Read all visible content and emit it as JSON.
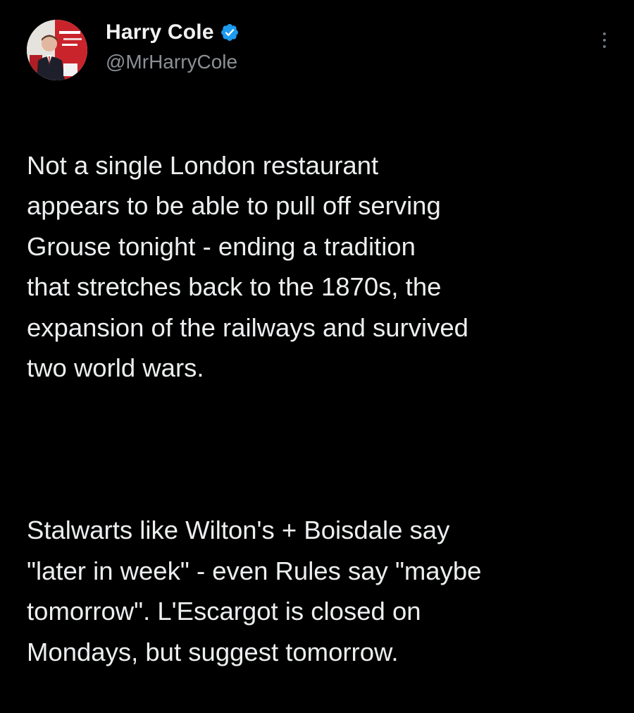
{
  "tweet": {
    "author": {
      "display_name": "Harry Cole",
      "handle": "@MrHarryCole",
      "verified": true,
      "verified_color": "#1d9bf0"
    },
    "paragraphs": [
      "Not a single London restaurant\nappears to be able to pull off serving\nGrouse tonight - ending a tradition\nthat stretches back to the 1870s, the\nexpansion of the railways and survived\ntwo world wars.",
      "Stalwarts like Wilton's + Boisdale say\n\"later in week\" - even Rules say \"maybe\ntomorrow\". L'Escargot is closed on\nMondays, but suggest tomorrow."
    ],
    "icons": {
      "verified": "verified-badge-icon",
      "menu": "more-options-icon"
    },
    "colors": {
      "background": "#000000",
      "text": "#e7e9ea",
      "secondary_text": "#8b9095"
    }
  }
}
